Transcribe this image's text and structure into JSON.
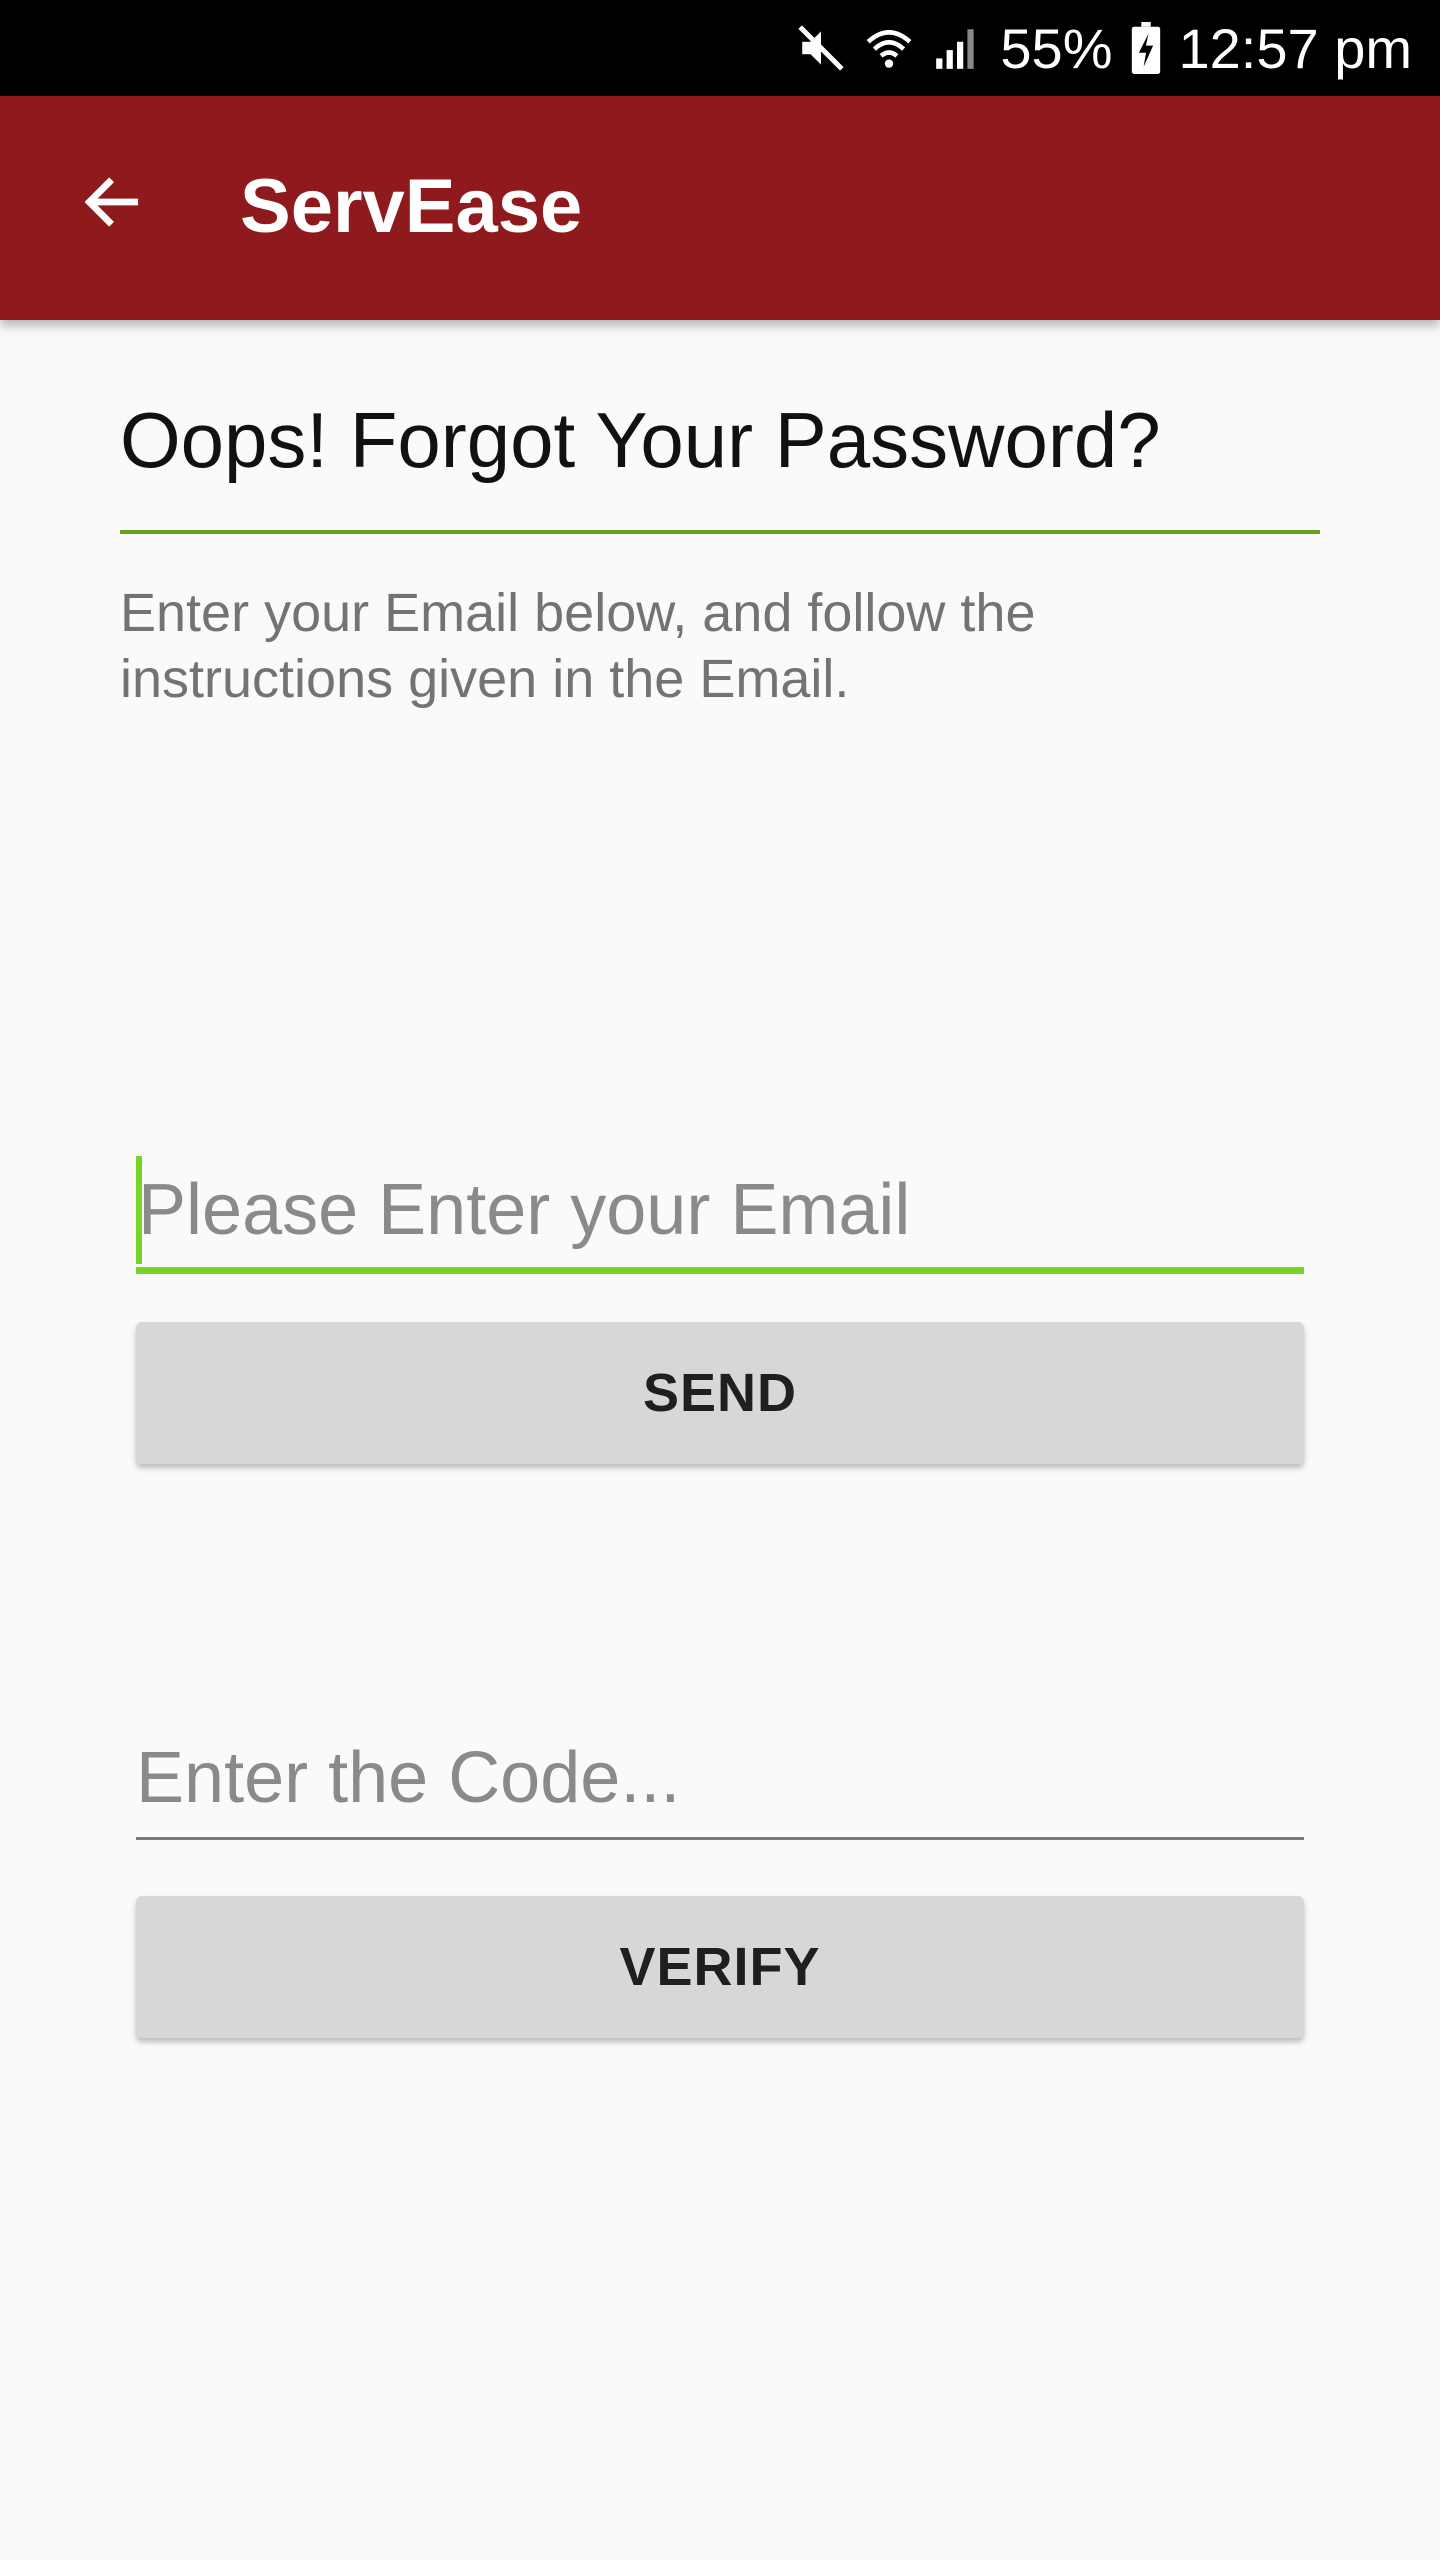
{
  "status_bar": {
    "battery": "55%",
    "time": "12:57 pm",
    "icons": [
      "mute-icon",
      "wifi-icon",
      "signal-icon",
      "battery-icon"
    ]
  },
  "app_bar": {
    "title": "ServEase",
    "back_icon": "arrow-back-icon",
    "color": "#8e1a1d"
  },
  "main": {
    "heading": "Oops! Forgot Your Password?",
    "instructions": "Enter your Email below, and follow the instructions given in the Email.",
    "email_field": {
      "value": "",
      "placeholder": "Please Enter your Email"
    },
    "send_label": "SEND",
    "code_field": {
      "value": "",
      "placeholder": "Enter the Code..."
    },
    "verify_label": "VERIFY"
  },
  "colors": {
    "accent": "#78d42a",
    "heading_rule": "#6a9e1f",
    "button_bg": "#d6d7d7"
  }
}
